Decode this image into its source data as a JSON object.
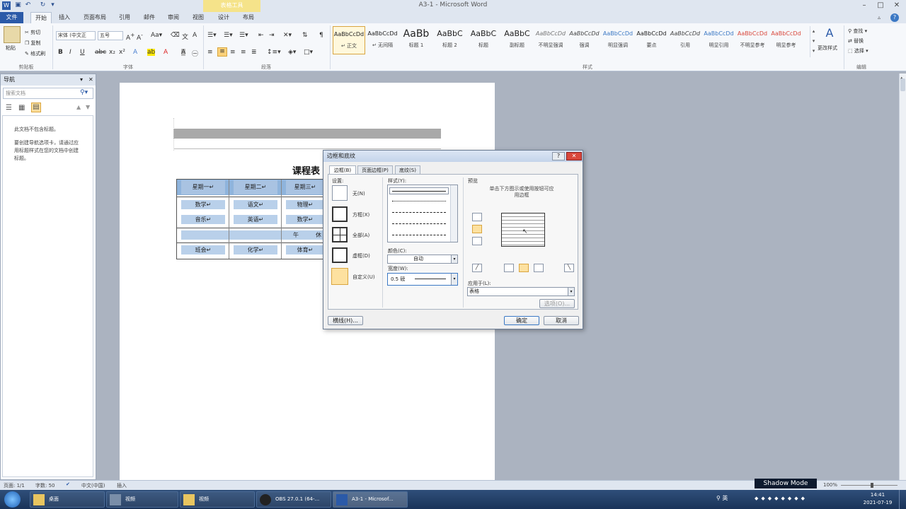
{
  "window": {
    "title": "A3-1 - Microsoft Word"
  },
  "ribbon_context": {
    "label": "表格工具"
  },
  "tabs": [
    "文件",
    "开始",
    "插入",
    "页面布局",
    "引用",
    "邮件",
    "审阅",
    "视图",
    "设计",
    "布局"
  ],
  "clipboard": {
    "paste": "粘贴",
    "cut": "剪切",
    "copy": "复制",
    "format_painter": "格式刷",
    "label": "剪贴板"
  },
  "font": {
    "name": "宋体 (中文正",
    "size": "五号",
    "label": "字体"
  },
  "paragraph": {
    "label": "段落"
  },
  "styles": {
    "label": "样式",
    "items": [
      {
        "preview": "AaBbCcDd",
        "name": "↵ 正文"
      },
      {
        "preview": "AaBbCcDd",
        "name": "↵ 无间隔"
      },
      {
        "preview": "AaBb",
        "name": "标题 1"
      },
      {
        "preview": "AaBbC",
        "name": "标题 2"
      },
      {
        "preview": "AaBbC",
        "name": "标题"
      },
      {
        "preview": "AaBbC",
        "name": "副标题"
      },
      {
        "preview": "AaBbCcDd",
        "name": "不明显强调"
      },
      {
        "preview": "AaBbCcDd",
        "name": "强调"
      },
      {
        "preview": "AaBbCcDd",
        "name": "明显强调"
      },
      {
        "preview": "AaBbCcDd",
        "name": "要点"
      },
      {
        "preview": "AaBbCcDd",
        "name": "引用"
      },
      {
        "preview": "AaBbCcDd",
        "name": "明显引用"
      },
      {
        "preview": "AaBbCcDd",
        "name": "不明显参考"
      },
      {
        "preview": "AaBbCcDd",
        "name": "明显参考"
      }
    ],
    "change": "更改样式"
  },
  "editing": {
    "find": "查找",
    "replace": "替换",
    "select": "选择",
    "label": "编辑"
  },
  "nav": {
    "title": "导航",
    "search_placeholder": "搜索文档",
    "message1": "此文档不包含标题。",
    "message2": "要创建导航选项卡，请通过应用标题样式在您的文档中创建标题。"
  },
  "doc": {
    "table_title": "课程表",
    "rows": [
      [
        "星期一↵",
        "星期二↵",
        "星期三↵"
      ],
      [
        "数学↵",
        "语文↵",
        "物理↵"
      ],
      [
        "音乐↵",
        "英语↵",
        "数学↵"
      ],
      [
        "午",
        "休"
      ],
      [
        "班会↵",
        "化学↵",
        "体育↵"
      ]
    ]
  },
  "dialog": {
    "title": "边框和底纹",
    "tabs": [
      "边框(B)",
      "页面边框(P)",
      "底纹(S)"
    ],
    "setting_label": "设置:",
    "settings": [
      "无(N)",
      "方框(X)",
      "全部(A)",
      "虚框(D)",
      "自定义(U)"
    ],
    "style_label": "样式(Y):",
    "color_label": "颜色(C):",
    "color_value": "自动",
    "width_label": "宽度(W):",
    "width_value": "0.5 磅",
    "preview_label": "预览",
    "preview_hint": "单击下方图示或使用按钮可应用边框",
    "apply_label": "应用于(L):",
    "apply_value": "表格",
    "options": "选项(O)...",
    "hline": "横线(H)...",
    "ok": "确定",
    "cancel": "取消"
  },
  "status": {
    "page": "页面: 1/1",
    "words": "字数: 50",
    "lang": "中文(中国)",
    "mode": "插入",
    "zoom": "100%"
  },
  "taskbar": {
    "items": [
      "桌面",
      "视频",
      "视频",
      "OBS 27.0.1 (64-...",
      "A3-1 - Microsof..."
    ],
    "ime": "英",
    "time": "14:41",
    "date": "2021-07-19"
  },
  "overlay": {
    "shadow_mode": "Shadow Mode"
  }
}
